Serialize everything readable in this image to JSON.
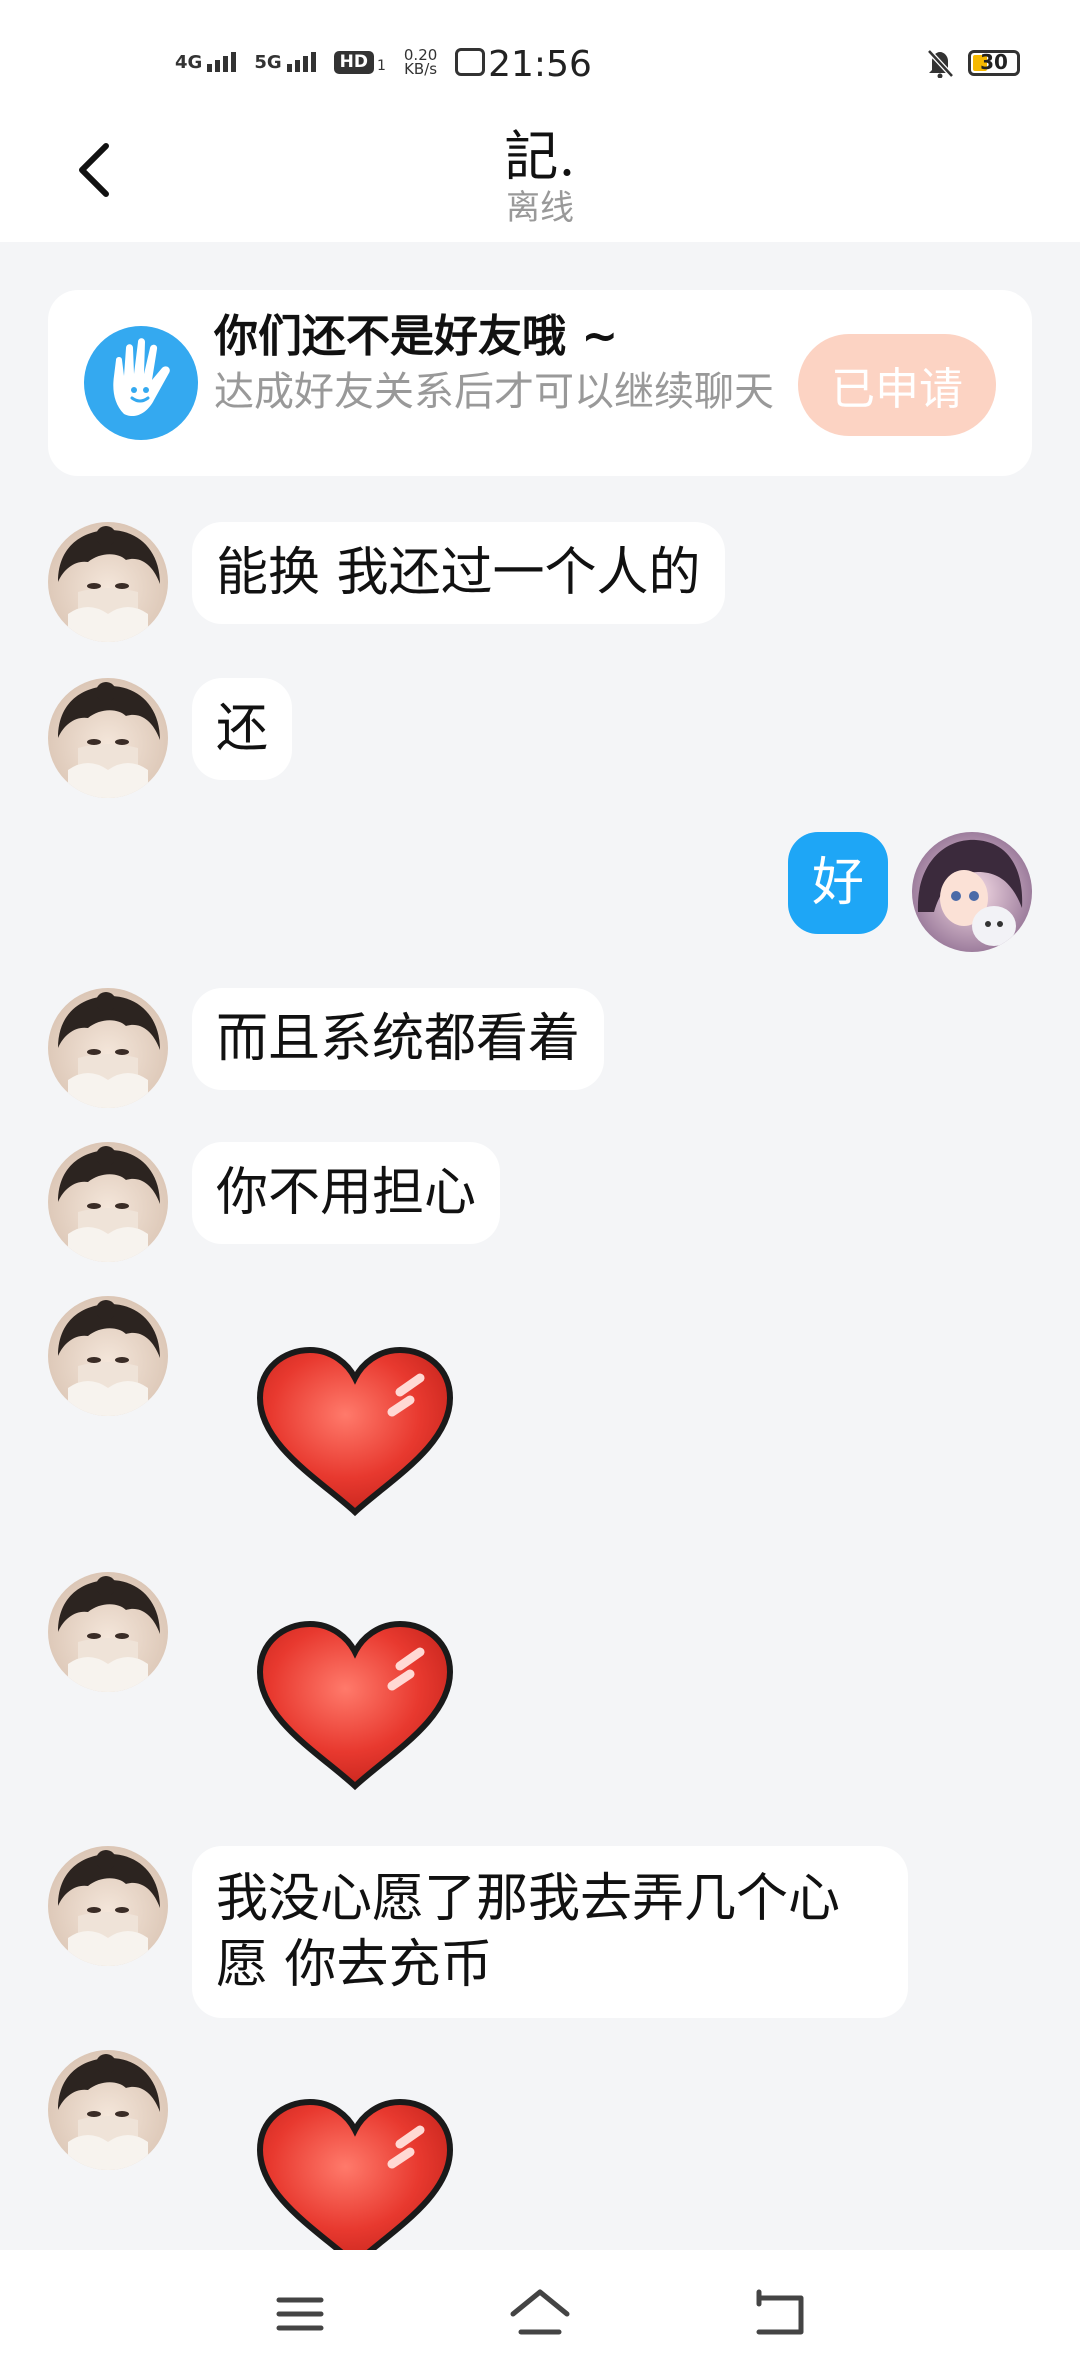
{
  "status_bar": {
    "network_1": "4G",
    "network_2": "5G",
    "hd": "HD",
    "hd_sub": "1",
    "speed_value": "0.20",
    "speed_unit": "KB/s",
    "time": "21:56",
    "battery": "30"
  },
  "header": {
    "title": "記.",
    "status": "离线"
  },
  "friend_banner": {
    "title": "你们还不是好友哦 ~",
    "description": "达成好友关系后才可以继续聊天",
    "button_label": "已申请"
  },
  "messages": [
    {
      "from": "other",
      "type": "text",
      "text": "能换 我还过一个人的"
    },
    {
      "from": "other",
      "type": "text",
      "text": "还"
    },
    {
      "from": "self",
      "type": "text",
      "text": "好"
    },
    {
      "from": "other",
      "type": "text",
      "text": "而且系统都看着"
    },
    {
      "from": "other",
      "type": "text",
      "text": "你不用担心"
    },
    {
      "from": "other",
      "type": "sticker",
      "sticker": "red-heart"
    },
    {
      "from": "other",
      "type": "sticker",
      "sticker": "red-heart"
    },
    {
      "from": "other",
      "type": "text",
      "text": "我没心愿了那我去弄几个心愿 你去充币"
    },
    {
      "from": "other",
      "type": "sticker",
      "sticker": "red-heart"
    }
  ],
  "colors": {
    "accent": "#1ea6f6",
    "apply_button": "#fcd3c3",
    "background": "#f4f5f7",
    "heart": "#e8392f"
  },
  "icons": [
    "back-icon",
    "hand-wave-icon",
    "bell-muted-icon",
    "menu-icon",
    "home-icon",
    "back-nav-icon"
  ]
}
